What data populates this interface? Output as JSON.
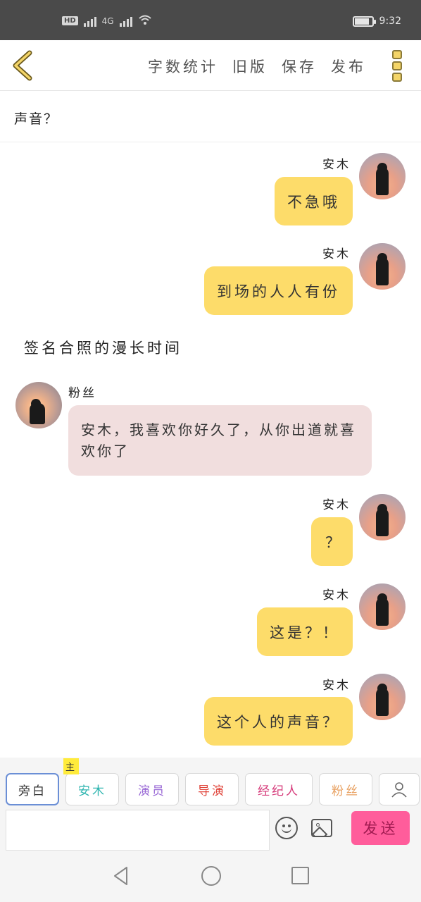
{
  "status_bar": {
    "network": "4G",
    "time": "9:32"
  },
  "toolbar": {
    "back_icon": "chevron-left-icon",
    "actions": [
      "字数统计",
      "旧版",
      "保存",
      "发布"
    ],
    "more_icon": "more-vertical-icon",
    "accent_color": "#f4d568"
  },
  "title": "声音？",
  "messages": [
    {
      "side": "right",
      "sender": "安木",
      "text": "不急哦"
    },
    {
      "side": "right",
      "sender": "安木",
      "text": "到场的人人有份"
    },
    {
      "type": "narration",
      "text": "签名合照的漫长时间"
    },
    {
      "side": "left",
      "sender": "粉丝",
      "text": "安木，我喜欢你好久了，从你出道就喜欢你了"
    },
    {
      "side": "right",
      "sender": "安木",
      "text": "？"
    },
    {
      "side": "right",
      "sender": "安木",
      "text": "这是？！"
    },
    {
      "side": "right",
      "sender": "安木",
      "text": "这个人的声音？"
    }
  ],
  "colors": {
    "bubble_self": "#fddc6a",
    "bubble_other": "#f1dede",
    "send_button": "#ff5d9b"
  },
  "roles": [
    {
      "label": "旁白",
      "color": "#333333",
      "active": true
    },
    {
      "label": "安木",
      "color": "#2fb5b0",
      "tag": "主"
    },
    {
      "label": "演员",
      "color": "#9a6ad6"
    },
    {
      "label": "导演",
      "color": "#e0443a"
    },
    {
      "label": "经纪人",
      "color": "#d63a7a"
    },
    {
      "label": "粉丝",
      "color": "#e8a060"
    }
  ],
  "input": {
    "value": "",
    "placeholder": ""
  },
  "send_label": "发送"
}
